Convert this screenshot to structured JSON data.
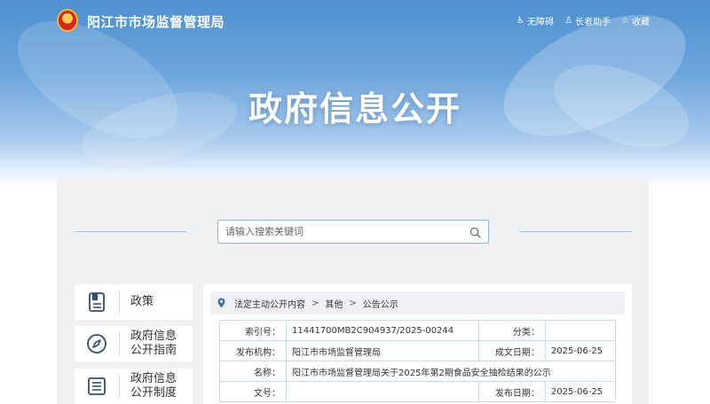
{
  "header": {
    "site_title": "阳江市市场监督管理局",
    "tools": [
      {
        "label": "无障碍",
        "icon": "accessibility-icon"
      },
      {
        "label": "长者助手",
        "icon": "elder-assist-icon"
      },
      {
        "label": "收藏",
        "icon": "star-icon"
      }
    ]
  },
  "hero": {
    "title": "政府信息公开"
  },
  "search": {
    "placeholder": "请输入搜索关键词"
  },
  "sidebar": {
    "items": [
      {
        "label": "政策",
        "icon": "document-icon"
      },
      {
        "label": "政府信息公开指南",
        "line1": "政府信息",
        "line2": "公开指南",
        "icon": "compass-icon"
      },
      {
        "label": "政府信息公开制度",
        "line1": "政府信息",
        "line2": "公开制度",
        "icon": "list-icon"
      }
    ]
  },
  "breadcrumb": {
    "items": [
      "法定主动公开内容",
      "其他",
      "公告公示"
    ],
    "separator": ">"
  },
  "details": {
    "index_label": "索引号：",
    "index_value": "11441700MB2C904937/2025-00244",
    "category_label": "分类：",
    "category_value": "",
    "publisher_label": "发布机构：",
    "publisher_value": "阳江市市场监督管理局",
    "created_label": "成文日期：",
    "created_value": "2025-06-25",
    "name_label": "名称：",
    "name_value": "阳江市市场监督管理局关于2025年第2期食品安全抽检结果的公示",
    "docno_label": "文号：",
    "docno_value": "",
    "published_label": "发布日期：",
    "published_value": "2025-06-25"
  },
  "colors": {
    "hero_blue": "#4d8fcf",
    "accent_blue": "#3d6fa8",
    "panel_gray": "#f0f1f3",
    "table_border": "#c9dcef"
  }
}
